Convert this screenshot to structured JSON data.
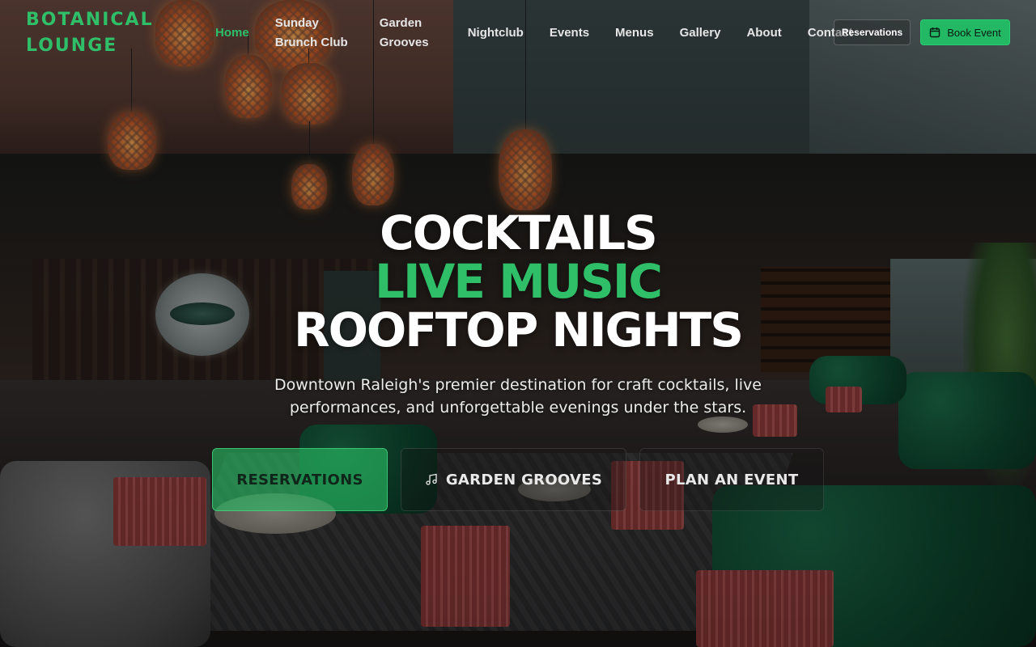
{
  "brand": {
    "line1": "BOTANICAL",
    "line2": "LOUNGE",
    "color": "#2fbf68"
  },
  "nav": {
    "items": [
      {
        "label": "Home",
        "active": true
      },
      {
        "label": "Sunday Brunch Club",
        "active": false
      },
      {
        "label": "Garden Grooves",
        "active": false
      },
      {
        "label": "Nightclub",
        "active": false
      },
      {
        "label": "Events",
        "active": false
      },
      {
        "label": "Menus",
        "active": false
      },
      {
        "label": "Gallery",
        "active": false
      },
      {
        "label": "About",
        "active": false
      },
      {
        "label": "Contact",
        "active": false
      }
    ],
    "reservations_label": "Reservations",
    "book_event_label": "Book Event",
    "book_event_icon": "calendar-icon"
  },
  "hero": {
    "line1": "COCKTAILS",
    "line2": "LIVE MUSIC",
    "line3": "ROOFTOP NIGHTS",
    "subtitle": "Downtown Raleigh's premier destination for craft cocktails, live performances, and unforgettable evenings under the stars.",
    "cta": {
      "reservations": "RESERVATIONS",
      "garden_grooves": "GARDEN GROOVES",
      "garden_grooves_icon": "music-note-icon",
      "plan_event": "PLAN AN EVENT"
    }
  },
  "colors": {
    "accent": "#2fbf68",
    "button_primary": "#22b864",
    "text": "#ffffff"
  }
}
